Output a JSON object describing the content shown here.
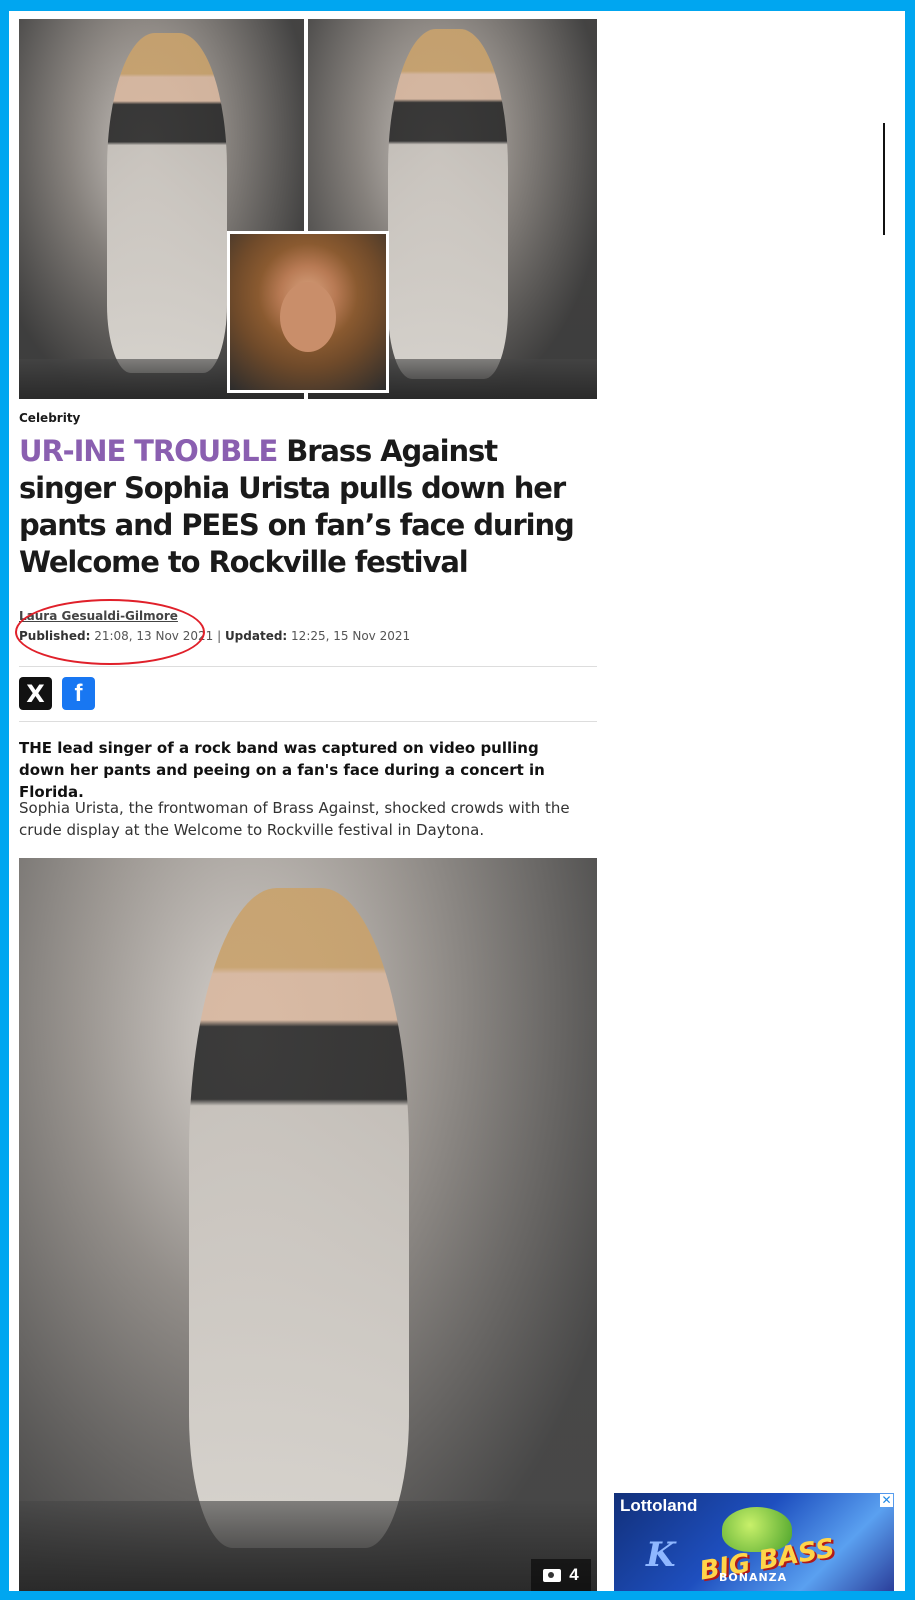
{
  "article": {
    "category": "Celebrity",
    "headline_tag": "UR-INE TROUBLE",
    "headline_rest": " Brass Against singer Sophia Urista pulls down her pants and PEES on fan’s face during Welcome to Rockville festival",
    "author": "Laura Gesualdi-Gilmore",
    "published_label": "Published:",
    "published_value": " 21:08, 13 Nov 2021",
    "separator": " | ",
    "updated_label": "Updated:",
    "updated_value": " 12:25, 15 Nov 2021",
    "lead": "THE lead singer of a rock band was captured on video pulling down her pants and peeing on a fan's face during a concert in Florida.",
    "paragraph": "Sophia Urista, the frontwoman of Brass Against, shocked crowds with the crude display at the Welcome to Rockville festival in Daytona.",
    "photo_count": "4"
  },
  "share": {
    "x_icon": "X",
    "facebook_icon": "f"
  },
  "ad": {
    "brand": "Lottoland",
    "close": "✕",
    "k_letter": "K",
    "game": "BIG BASS",
    "game_sub": "BONANZA"
  },
  "colors": {
    "frame_border": "#00a6f0",
    "headline_tag": "#8a5fb0",
    "annotation_circle": "#e0202a",
    "facebook": "#1877f2"
  }
}
